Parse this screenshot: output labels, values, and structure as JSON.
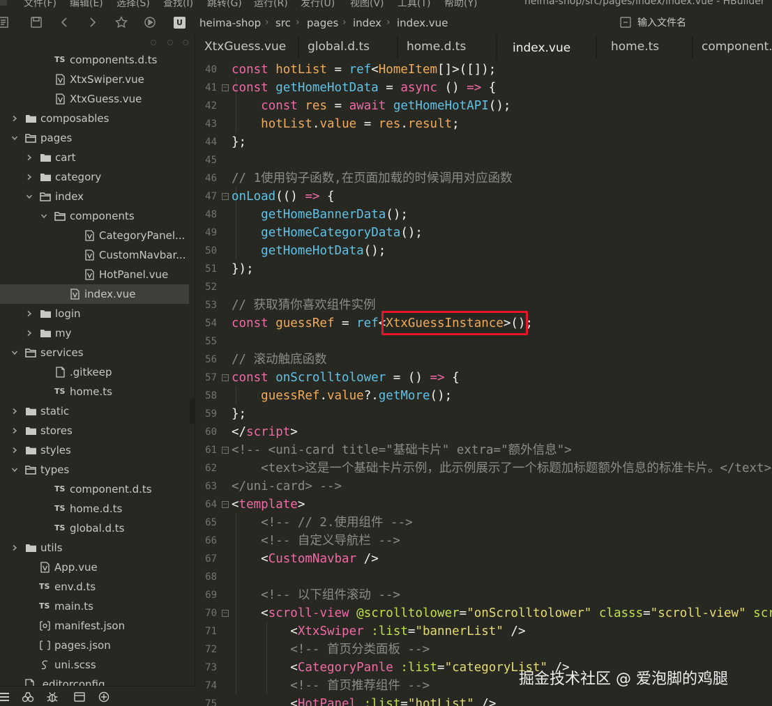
{
  "menubar": {
    "items": [
      "文件(F)",
      "编辑(E)",
      "选择(S)",
      "查找(I)",
      "跳转(G)",
      "运行(R)",
      "发行(U)",
      "视图(V)",
      "工具(T)",
      "帮助(Y)"
    ],
    "window_title": "heima-shop/src/pages/index/index.vue - HBuilder"
  },
  "breadcrumb": {
    "segments": [
      "heima-shop",
      "src",
      "pages",
      "index",
      "index.vue"
    ],
    "badge": "U"
  },
  "file_search": {
    "placeholder": "输入文件名"
  },
  "tree": [
    {
      "icon": "ts",
      "name": "components.d.ts"
    },
    {
      "icon": "vue",
      "name": "XtxSwiper.vue"
    },
    {
      "icon": "vue",
      "name": "XtxGuess.vue"
    },
    {
      "icon": "folder",
      "name": "composables",
      "expanded": false
    },
    {
      "icon": "folder-open",
      "name": "pages",
      "expanded": true
    },
    {
      "icon": "folder",
      "name": "cart",
      "expanded": false
    },
    {
      "icon": "folder",
      "name": "category",
      "expanded": false
    },
    {
      "icon": "folder-open",
      "name": "index",
      "expanded": true
    },
    {
      "icon": "folder-open",
      "name": "components",
      "expanded": true
    },
    {
      "icon": "vue",
      "name": "CategoryPanel..."
    },
    {
      "icon": "vue",
      "name": "CustomNavbar..."
    },
    {
      "icon": "vue",
      "name": "HotPanel.vue"
    },
    {
      "icon": "vue",
      "name": "index.vue",
      "selected": true
    },
    {
      "icon": "folder",
      "name": "login",
      "expanded": false
    },
    {
      "icon": "folder",
      "name": "my",
      "expanded": false
    },
    {
      "icon": "folder-open",
      "name": "services",
      "expanded": true
    },
    {
      "icon": "file",
      "name": ".gitkeep"
    },
    {
      "icon": "ts",
      "name": "home.ts"
    },
    {
      "icon": "folder",
      "name": "static",
      "expanded": false
    },
    {
      "icon": "folder",
      "name": "stores",
      "expanded": false
    },
    {
      "icon": "folder",
      "name": "styles",
      "expanded": false
    },
    {
      "icon": "folder-open",
      "name": "types",
      "expanded": true
    },
    {
      "icon": "ts",
      "name": "component.d.ts"
    },
    {
      "icon": "ts",
      "name": "home.d.ts"
    },
    {
      "icon": "ts",
      "name": "global.d.ts"
    },
    {
      "icon": "folder",
      "name": "utils",
      "expanded": false
    },
    {
      "icon": "vue",
      "name": "App.vue"
    },
    {
      "icon": "ts",
      "name": "env.d.ts"
    },
    {
      "icon": "ts",
      "name": "main.ts"
    },
    {
      "icon": "json-gear",
      "name": "manifest.json"
    },
    {
      "icon": "json",
      "name": "pages.json"
    },
    {
      "icon": "scss",
      "name": "uni.scss"
    },
    {
      "icon": "file",
      "name": ".editorconfig"
    }
  ],
  "tabs": [
    {
      "label": "XtxGuess.vue",
      "active": false
    },
    {
      "label": "global.d.ts",
      "active": false
    },
    {
      "label": "home.d.ts",
      "active": false
    },
    {
      "label": "index.vue",
      "active": true
    },
    {
      "label": "home.ts",
      "active": false
    },
    {
      "label": "component.d.ts",
      "active": false
    }
  ],
  "code": [
    {
      "n": "40",
      "fold": false,
      "tokens": [
        [
          "kw",
          "const "
        ],
        [
          "var",
          "hotList"
        ],
        [
          "pun",
          " = "
        ],
        [
          "fn",
          "ref"
        ],
        [
          "pun",
          "<"
        ],
        [
          "type",
          "HomeItem"
        ],
        [
          "pun",
          "[]>([]);"
        ]
      ]
    },
    {
      "n": "41",
      "fold": true,
      "tokens": [
        [
          "kw",
          "const "
        ],
        [
          "fn",
          "getHomeHotData"
        ],
        [
          "pun",
          " = "
        ],
        [
          "kw",
          "async"
        ],
        [
          "pun",
          " () "
        ],
        [
          "kw",
          "=>"
        ],
        [
          "pun",
          " {"
        ]
      ]
    },
    {
      "n": "42",
      "fold": false,
      "tokens": [
        [
          "plain",
          "    "
        ],
        [
          "kw",
          "const "
        ],
        [
          "var",
          "res"
        ],
        [
          "pun",
          " = "
        ],
        [
          "kw",
          "await "
        ],
        [
          "fn",
          "getHomeHotAPI"
        ],
        [
          "pun",
          "();"
        ]
      ]
    },
    {
      "n": "43",
      "fold": false,
      "tokens": [
        [
          "plain",
          "    "
        ],
        [
          "var",
          "hotList"
        ],
        [
          "pun",
          "."
        ],
        [
          "var",
          "value"
        ],
        [
          "pun",
          " = "
        ],
        [
          "var",
          "res"
        ],
        [
          "pun",
          "."
        ],
        [
          "var",
          "result"
        ],
        [
          "pun",
          ";"
        ]
      ]
    },
    {
      "n": "44",
      "fold": false,
      "tokens": [
        [
          "pun",
          "};"
        ]
      ]
    },
    {
      "n": "45",
      "fold": false,
      "tokens": []
    },
    {
      "n": "46",
      "fold": false,
      "tokens": [
        [
          "cmt",
          "// 1使用钩子函数,在页面加载的时候调用对应函数"
        ]
      ]
    },
    {
      "n": "47",
      "fold": true,
      "tokens": [
        [
          "fn",
          "onLoad"
        ],
        [
          "pun",
          "(() "
        ],
        [
          "kw",
          "=>"
        ],
        [
          "pun",
          " {"
        ]
      ]
    },
    {
      "n": "48",
      "fold": false,
      "tokens": [
        [
          "plain",
          "    "
        ],
        [
          "fn",
          "getHomeBannerData"
        ],
        [
          "pun",
          "();"
        ]
      ]
    },
    {
      "n": "49",
      "fold": false,
      "tokens": [
        [
          "plain",
          "    "
        ],
        [
          "fn",
          "getHomeCategoryData"
        ],
        [
          "pun",
          "();"
        ]
      ]
    },
    {
      "n": "50",
      "fold": false,
      "tokens": [
        [
          "plain",
          "    "
        ],
        [
          "fn",
          "getHomeHotData"
        ],
        [
          "pun",
          "();"
        ]
      ]
    },
    {
      "n": "51",
      "fold": false,
      "tokens": [
        [
          "pun",
          "});"
        ]
      ]
    },
    {
      "n": "52",
      "fold": false,
      "tokens": []
    },
    {
      "n": "53",
      "fold": false,
      "tokens": [
        [
          "cmt",
          "// 获取猜你喜欢组件实例"
        ]
      ]
    },
    {
      "n": "54",
      "fold": false,
      "tokens": [
        [
          "kw",
          "const "
        ],
        [
          "var",
          "guessRef"
        ],
        [
          "pun",
          " = "
        ],
        [
          "fn",
          "ref"
        ],
        [
          "pun",
          "<"
        ],
        [
          "type",
          "XtxGuessInstance"
        ],
        [
          "pun",
          ">();"
        ]
      ]
    },
    {
      "n": "55",
      "fold": false,
      "tokens": []
    },
    {
      "n": "56",
      "fold": false,
      "tokens": [
        [
          "cmt",
          "// 滚动触底函数"
        ]
      ]
    },
    {
      "n": "57",
      "fold": true,
      "tokens": [
        [
          "kw",
          "const "
        ],
        [
          "fn",
          "onScrolltolower"
        ],
        [
          "pun",
          " = () "
        ],
        [
          "kw",
          "=>"
        ],
        [
          "pun",
          " {"
        ]
      ]
    },
    {
      "n": "58",
      "fold": false,
      "tokens": [
        [
          "plain",
          "    "
        ],
        [
          "var",
          "guessRef"
        ],
        [
          "pun",
          "."
        ],
        [
          "var",
          "value"
        ],
        [
          "pun",
          "?."
        ],
        [
          "fn",
          "getMore"
        ],
        [
          "pun",
          "();"
        ]
      ]
    },
    {
      "n": "59",
      "fold": false,
      "tokens": [
        [
          "pun",
          "};"
        ]
      ]
    },
    {
      "n": "60",
      "fold": false,
      "tokens": [
        [
          "pun",
          "</"
        ],
        [
          "tag",
          "script"
        ],
        [
          "pun",
          ">"
        ]
      ]
    },
    {
      "n": "61",
      "fold": true,
      "tokens": [
        [
          "cmt",
          "<!-- <uni-card title=\"基础卡片\" extra=\"额外信息\">"
        ]
      ]
    },
    {
      "n": "62",
      "fold": false,
      "tokens": [
        [
          "cmt",
          "    <text>这是一个基础卡片示例，此示例展示了一个标题加标题额外信息的标准卡片。</text>"
        ]
      ]
    },
    {
      "n": "63",
      "fold": false,
      "tokens": [
        [
          "cmt",
          "</uni-card> -->"
        ]
      ]
    },
    {
      "n": "64",
      "fold": true,
      "tokens": [
        [
          "pun",
          "<"
        ],
        [
          "tag",
          "template"
        ],
        [
          "pun",
          ">"
        ]
      ]
    },
    {
      "n": "65",
      "fold": false,
      "tokens": [
        [
          "cmt",
          "    <!-- // 2.使用组件 -->"
        ]
      ]
    },
    {
      "n": "66",
      "fold": false,
      "tokens": [
        [
          "cmt",
          "    <!-- 自定义导航栏 -->"
        ]
      ]
    },
    {
      "n": "67",
      "fold": false,
      "tokens": [
        [
          "plain",
          "    "
        ],
        [
          "pun",
          "<"
        ],
        [
          "tag",
          "CustomNavbar"
        ],
        [
          "pun",
          " />"
        ]
      ]
    },
    {
      "n": "68",
      "fold": false,
      "tokens": []
    },
    {
      "n": "69",
      "fold": false,
      "tokens": [
        [
          "cmt",
          "    <!-- 以下组件滚动 -->"
        ]
      ]
    },
    {
      "n": "70",
      "fold": true,
      "tokens": [
        [
          "plain",
          "    "
        ],
        [
          "pun",
          "<"
        ],
        [
          "tag",
          "scroll-view"
        ],
        [
          "pun",
          " "
        ],
        [
          "attr",
          "@scrolltolower"
        ],
        [
          "pun",
          "="
        ],
        [
          "str",
          "\"onScrolltolower\""
        ],
        [
          "pun",
          " "
        ],
        [
          "attr",
          "classs"
        ],
        [
          "pun",
          "="
        ],
        [
          "str",
          "\"scroll-view\""
        ],
        [
          "pun",
          " "
        ],
        [
          "attr",
          "scroll-y"
        ],
        [
          "pun",
          ">"
        ]
      ]
    },
    {
      "n": "71",
      "fold": false,
      "tokens": [
        [
          "plain",
          "        "
        ],
        [
          "pun",
          "<"
        ],
        [
          "tag",
          "XtxSwiper"
        ],
        [
          "pun",
          " "
        ],
        [
          "attr",
          ":list"
        ],
        [
          "pun",
          "="
        ],
        [
          "str",
          "\"bannerList\""
        ],
        [
          "pun",
          " />"
        ]
      ]
    },
    {
      "n": "72",
      "fold": false,
      "tokens": [
        [
          "cmt",
          "        <!-- 首页分类面板 -->"
        ]
      ]
    },
    {
      "n": "73",
      "fold": false,
      "tokens": [
        [
          "plain",
          "        "
        ],
        [
          "pun",
          "<"
        ],
        [
          "tag",
          "CategoryPanle"
        ],
        [
          "pun",
          " "
        ],
        [
          "attr",
          ":list"
        ],
        [
          "pun",
          "="
        ],
        [
          "str",
          "\"categoryList\""
        ],
        [
          "pun",
          " />"
        ]
      ]
    },
    {
      "n": "74",
      "fold": false,
      "tokens": [
        [
          "cmt",
          "        <!-- 首页推荐组件 -->"
        ]
      ]
    },
    {
      "n": "75",
      "fold": false,
      "tokens": [
        [
          "plain",
          "        "
        ],
        [
          "pun",
          "<"
        ],
        [
          "tag",
          "HotPanel"
        ],
        [
          "pun",
          " "
        ],
        [
          "attr",
          ":list"
        ],
        [
          "pun",
          "="
        ],
        [
          "str",
          "\"hotList\""
        ],
        [
          "pun",
          " />"
        ]
      ]
    }
  ],
  "watermark": "掘金技术社区 @ 爱泡脚的鸡腿"
}
